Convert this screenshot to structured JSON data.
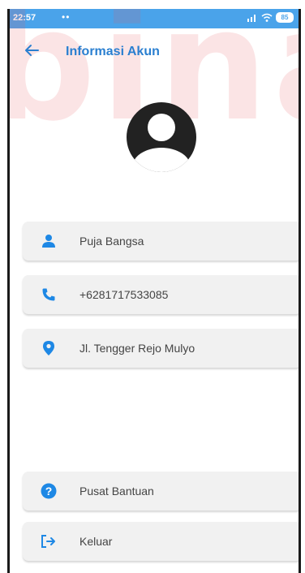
{
  "statusbar": {
    "time": "22:57",
    "dots": "••",
    "battery": "85"
  },
  "appbar": {
    "title": "Informasi Akun"
  },
  "watermark": "binar",
  "profile": {
    "name": "Puja Bangsa",
    "phone": "+6281717533085",
    "address": "Jl. Tengger Rejo Mulyo"
  },
  "menu": {
    "help": "Pusat Bantuan",
    "logout": "Keluar"
  },
  "colors": {
    "accent": "#2a7fd0",
    "statusbar": "#4aa3ea",
    "card": "#f1f1f1",
    "icon": "#1e88e5"
  }
}
